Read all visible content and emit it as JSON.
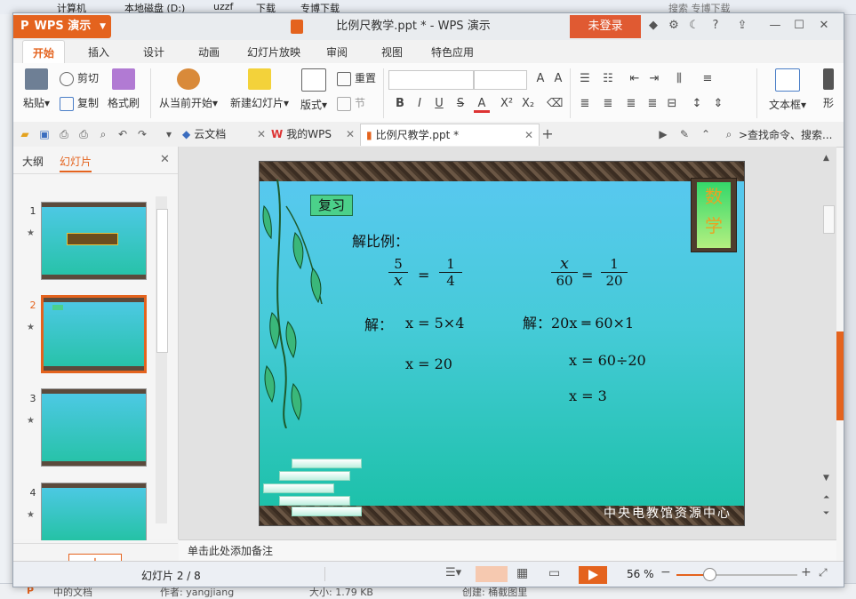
{
  "desktop": {
    "path_items": [
      "计算机",
      "本地磁盘 (D:)",
      "uzzf",
      "下载",
      "专博下载"
    ],
    "search_text": "搜索 专博下载",
    "bottom_items": [
      "P",
      "中的文档",
      "作者: yangjiang",
      "大小: 1.79 KB",
      "创建: 桶截图里"
    ]
  },
  "window": {
    "app_button": "WPS 演示",
    "title": "比例尺教学.ppt * - WPS 演示",
    "login_button": "未登录",
    "help_label": "?"
  },
  "tabs": [
    "开始",
    "插入",
    "设计",
    "动画",
    "幻灯片放映",
    "审阅",
    "视图",
    "特色应用"
  ],
  "ribbon": {
    "paste": "粘贴",
    "cut": "剪切",
    "copy": "复制",
    "format_painter": "格式刷",
    "from_current": "从当前开始",
    "new_slide": "新建幻灯片",
    "layout": "版式",
    "reset": "重置",
    "section": "节",
    "textbox": "文本框",
    "shape": "形"
  },
  "quick_bar": {
    "doc_tabs": [
      {
        "label": "云文档"
      },
      {
        "label": "我的WPS"
      },
      {
        "label": "比例尺教学.ppt *"
      }
    ],
    "search_placeholder": ">查找命令、搜索..."
  },
  "left_panel": {
    "tab_outline": "大纲",
    "tab_slides": "幻灯片",
    "slide_numbers": [
      "1",
      "2",
      "3",
      "4"
    ],
    "add_label": "+"
  },
  "slide": {
    "review_label": "复习",
    "math_chars": [
      "数",
      "学"
    ],
    "heading": "解比例：",
    "left_eq": {
      "n1": "5",
      "d1": "x",
      "n2": "1",
      "d2": "4"
    },
    "right_eq": {
      "n1": "x",
      "d1": "60",
      "n2": "1",
      "d2": "20"
    },
    "left_sol_1_prefix": "解：",
    "left_sol_1": "x = 5×4",
    "left_sol_2": "x = 20",
    "right_sol_1": "解：20x ═ 60×1",
    "right_sol_2": "x = 60÷20",
    "right_sol_3": "x = 3",
    "footer": "中央电教馆资源中心"
  },
  "notes_placeholder": "单击此处添加备注",
  "status": {
    "slide_counter": "幻灯片 2 / 8",
    "zoom": "56 %",
    "zoom_level": 0.56
  },
  "colors": {
    "accent": "#e4631e",
    "slide_top": "#5ac8f2",
    "slide_bottom": "#19c0a5"
  }
}
